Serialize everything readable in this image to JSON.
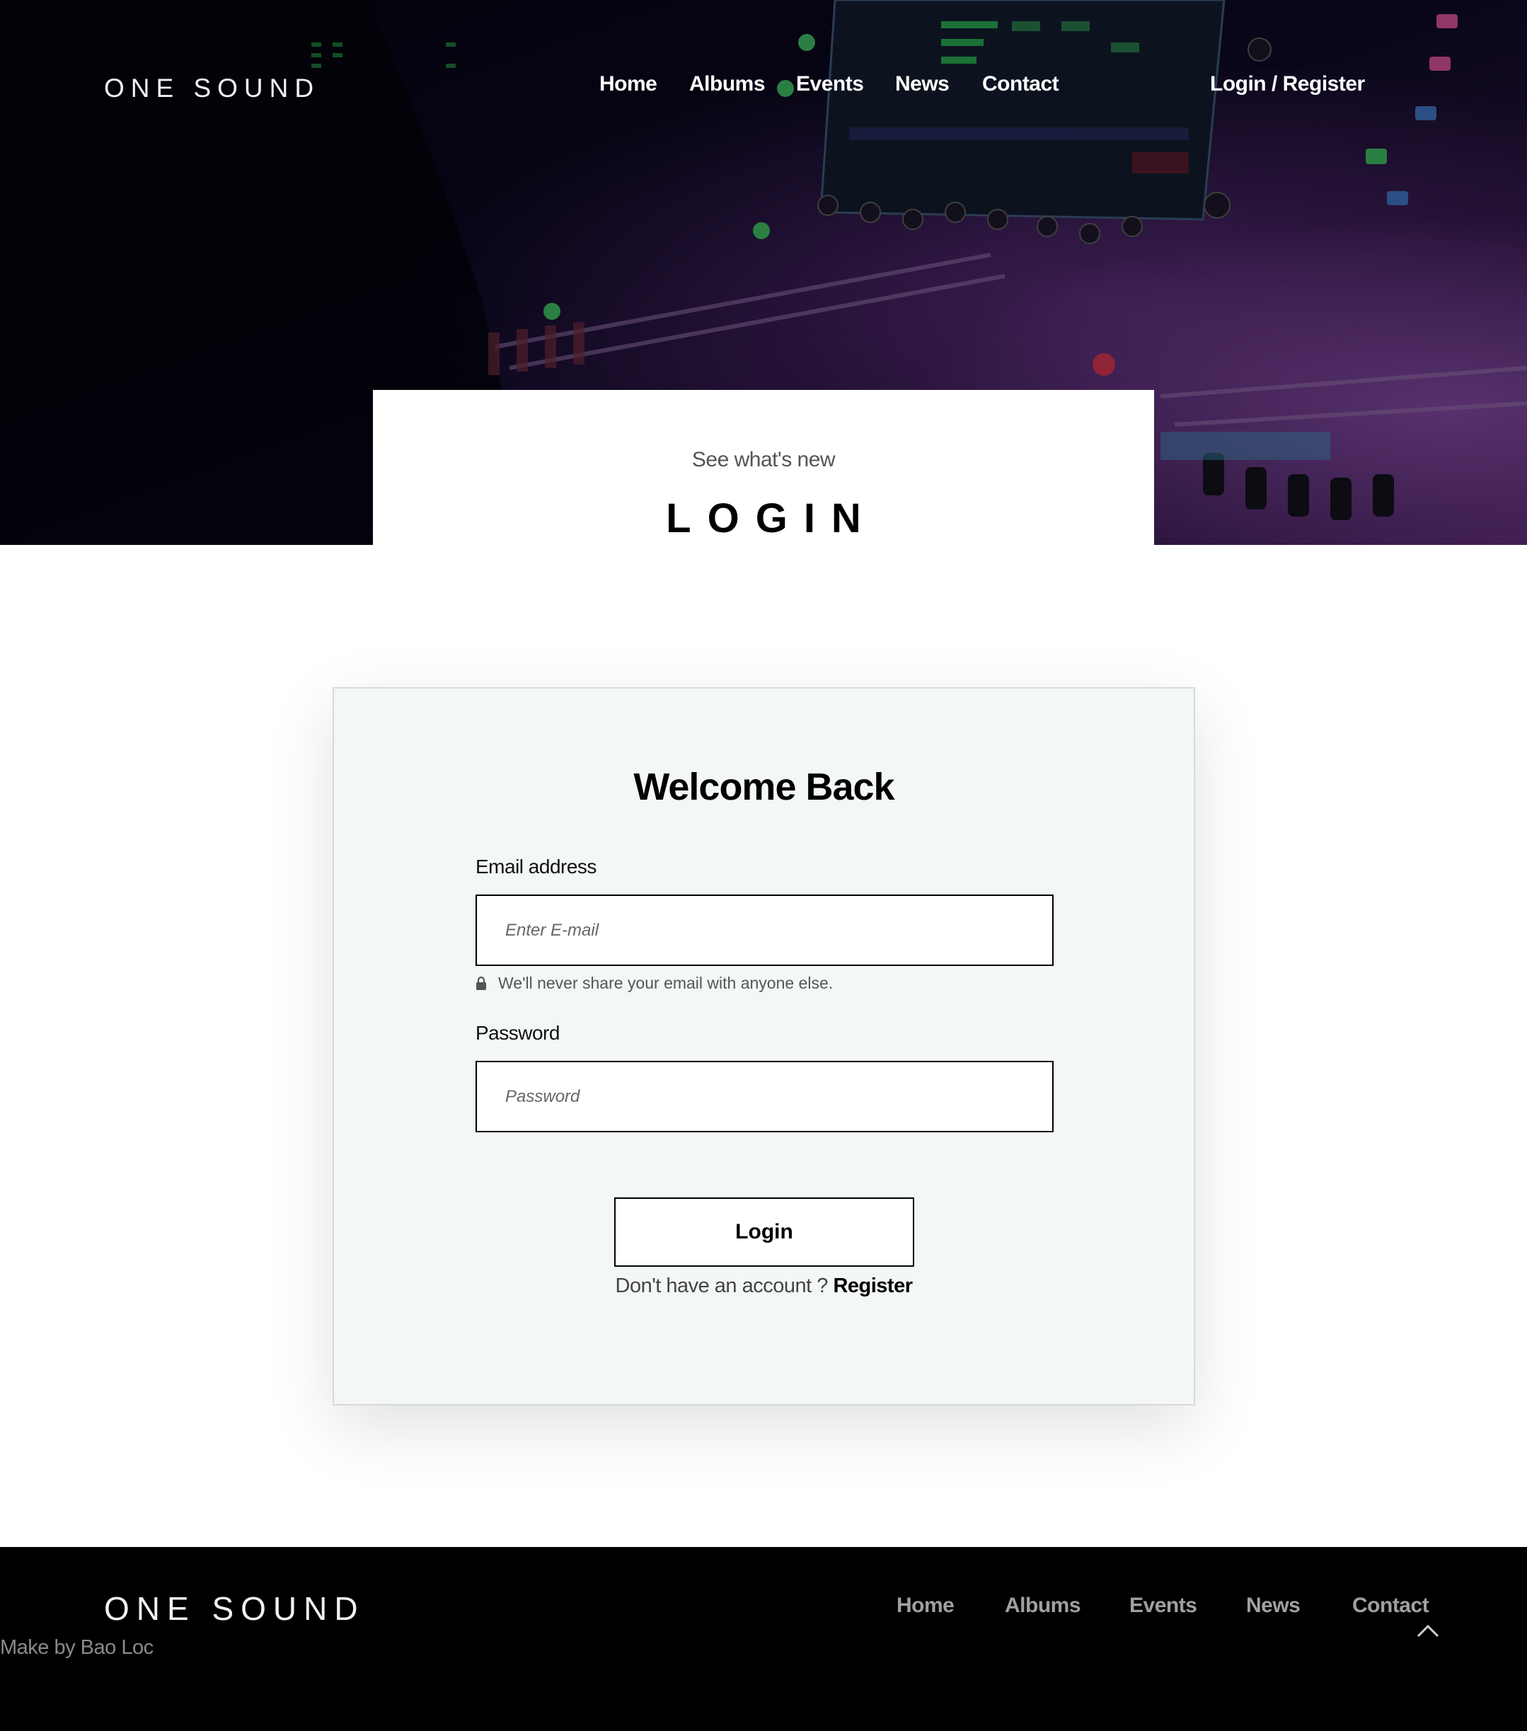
{
  "header": {
    "logo": "ONE SOUND",
    "nav": [
      "Home",
      "Albums",
      "Events",
      "News",
      "Contact"
    ],
    "login_register": "Login / Register"
  },
  "hero": {
    "subtitle": "See what's new",
    "title": "LOGIN"
  },
  "login_form": {
    "heading": "Welcome Back",
    "email_label": "Email address",
    "email_placeholder": "Enter E-mail",
    "email_help": "We'll never share your email with anyone else.",
    "password_label": "Password",
    "password_placeholder": "Password",
    "submit_label": "Login",
    "no_account_text": "Don't have an account ?",
    "register_link": "Register"
  },
  "footer": {
    "logo": "ONE SOUND",
    "credit": "Make by Bao Loc",
    "nav": [
      "Home",
      "Albums",
      "Events",
      "News",
      "Contact"
    ]
  },
  "icons": {
    "lock": "lock-icon",
    "scroll_top": "chevron-up-icon"
  },
  "colors": {
    "footer_bg": "#000000",
    "card_bg": "#f4f7f8",
    "hero_tint": "#5a1f6e"
  }
}
